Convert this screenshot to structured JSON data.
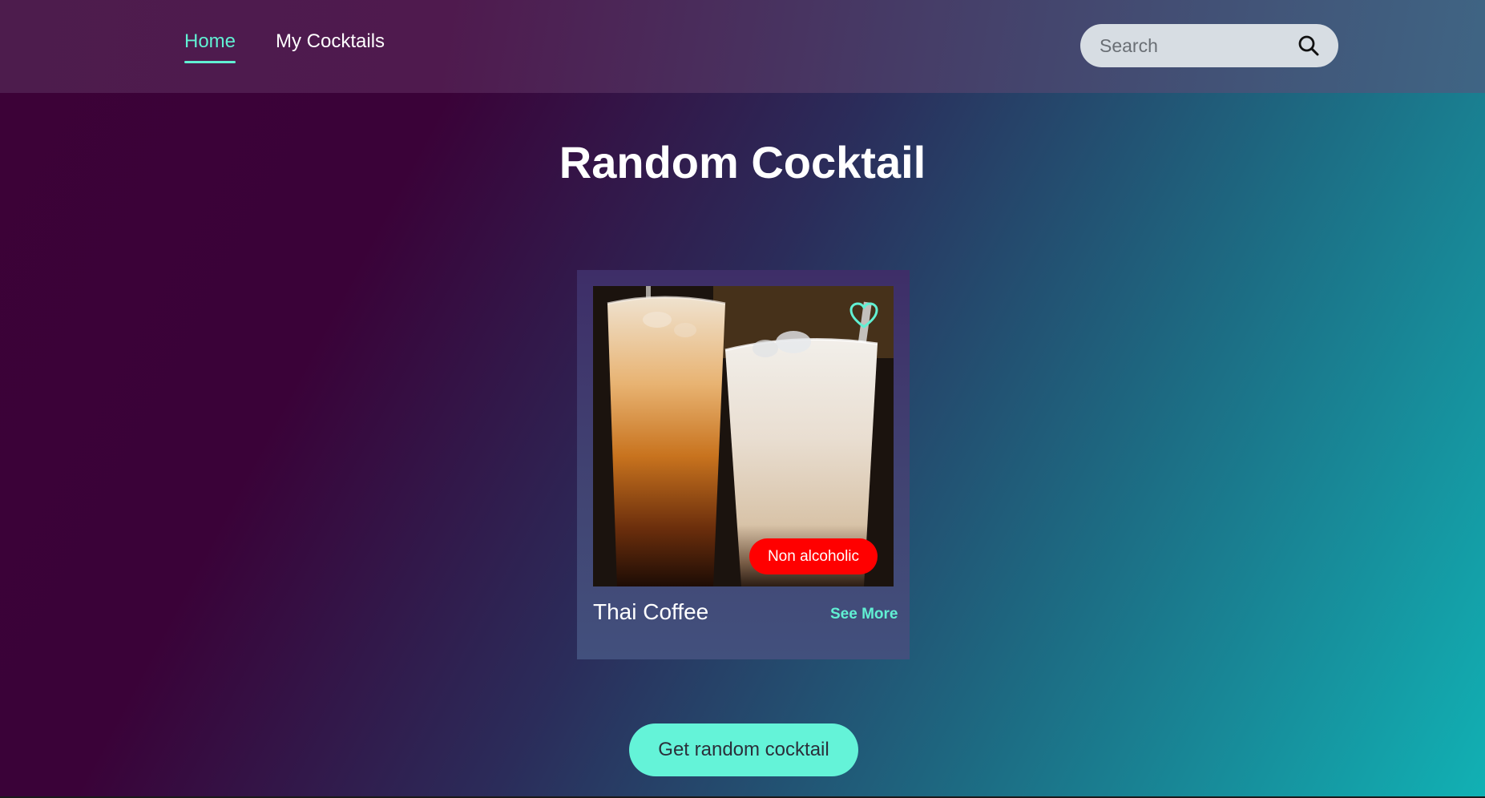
{
  "nav": {
    "items": [
      {
        "label": "Home",
        "active": true
      },
      {
        "label": "My Cocktails",
        "active": false
      }
    ]
  },
  "search": {
    "placeholder": "Search",
    "value": "",
    "icon": "search-icon"
  },
  "page": {
    "title": "Random Cocktail"
  },
  "cocktail": {
    "name": "Thai Coffee",
    "category_badge": "Non alcoholic",
    "favorite_icon": "heart-outline-icon",
    "see_more_label": "See More"
  },
  "actions": {
    "random_button_label": "Get random cocktail"
  },
  "colors": {
    "accent": "#61f0d3",
    "badge": "#ff0000",
    "button": "#64f3d8"
  }
}
